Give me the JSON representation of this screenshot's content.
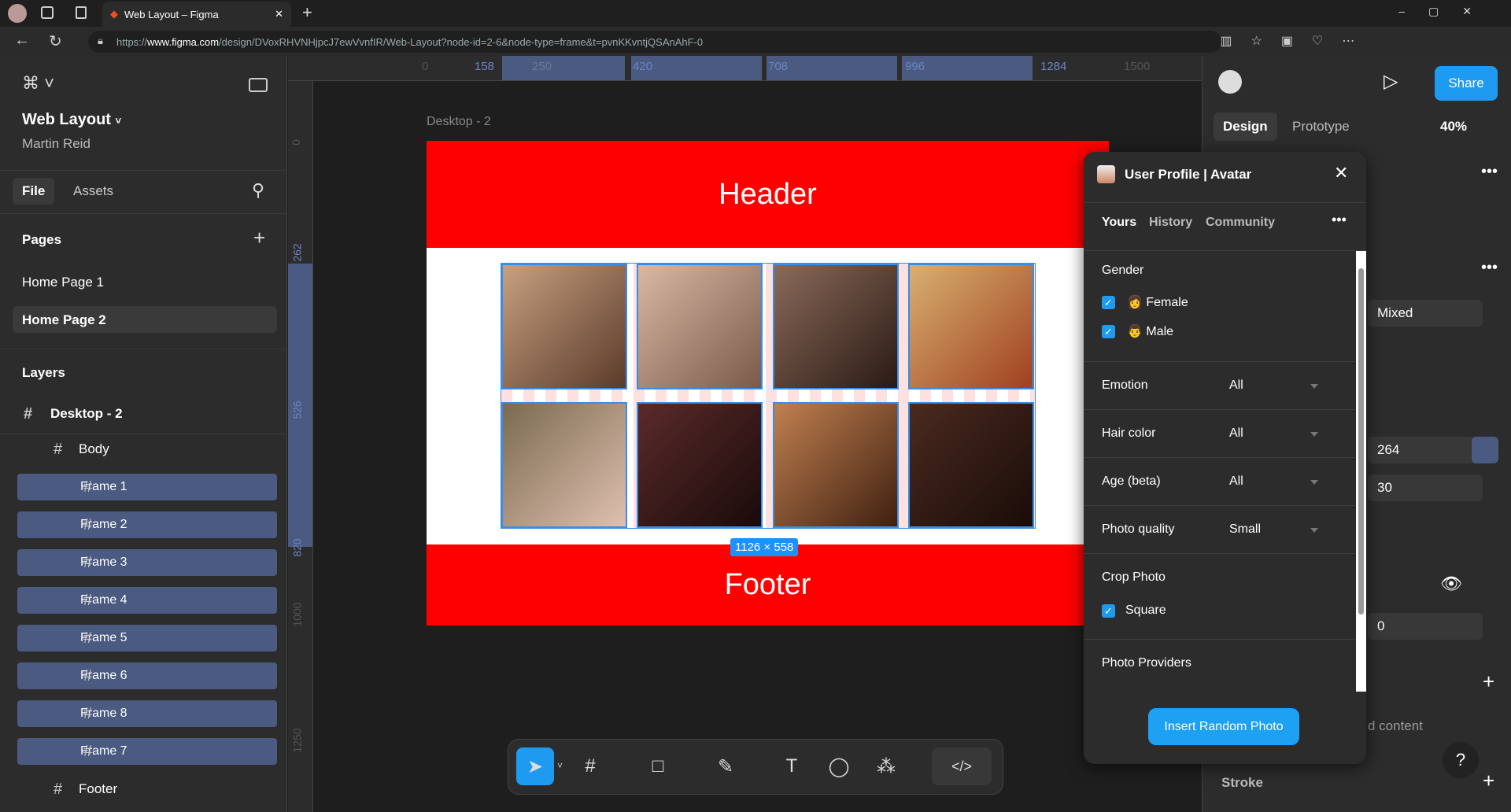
{
  "browser": {
    "tab_title": "Web Layout – Figma",
    "url_prefix": "https://",
    "url_host": "www.figma.com",
    "url_path": "/design/DVoxRHVNHjpcJ7ewVvnfIR/Web-Layout?node-id=2-6&node-type=frame&t=pvnKKvntjQSAnAhF-0"
  },
  "left": {
    "file_name": "Web Layout",
    "owner": "Martin Reid",
    "tabs": [
      "File",
      "Assets"
    ],
    "pages_title": "Pages",
    "pages": [
      "Home Page 1",
      "Home Page 2"
    ],
    "layers_title": "Layers",
    "layers": {
      "root": "Desktop - 2",
      "body": "Body",
      "frames": [
        "Frame 1",
        "Frame 2",
        "Frame 3",
        "Frame 4",
        "Frame 5",
        "Frame 6",
        "Frame 8",
        "Frame 7"
      ],
      "footer": "Footer"
    }
  },
  "rulers": {
    "top": [
      "0",
      "158",
      "250",
      "420",
      "708",
      "996",
      "1284",
      "1500"
    ],
    "left": [
      "0",
      "262",
      "526",
      "820",
      "1000",
      "1250"
    ]
  },
  "canvas": {
    "frame_label": "Desktop - 2",
    "header": "Header",
    "footer": "Footer",
    "selection_size": "1126 × 558",
    "colors": {
      "header": "#ff0000",
      "selection": "#1e90ff"
    }
  },
  "right": {
    "share": "Share",
    "tabs": [
      "Design",
      "Prototype"
    ],
    "zoom": "40%",
    "mixed": "Mixed",
    "w": "264",
    "h": "30",
    "opacity": "0",
    "content_partial": "d content",
    "stroke": "Stroke",
    "help": "?"
  },
  "plugin": {
    "title": "User Profile | Avatar",
    "tabs": [
      "Yours",
      "History",
      "Community"
    ],
    "gender_label": "Gender",
    "female": "Female",
    "male": "Male",
    "filters": [
      {
        "label": "Emotion",
        "value": "All"
      },
      {
        "label": "Hair color",
        "value": "All"
      },
      {
        "label": "Age (beta)",
        "value": "All"
      },
      {
        "label": "Photo quality",
        "value": "Small"
      }
    ],
    "crop_label": "Crop Photo",
    "crop_square": "Square",
    "providers": "Photo Providers",
    "insert": "Insert Random Photo",
    "accent": "#1da1f2"
  }
}
